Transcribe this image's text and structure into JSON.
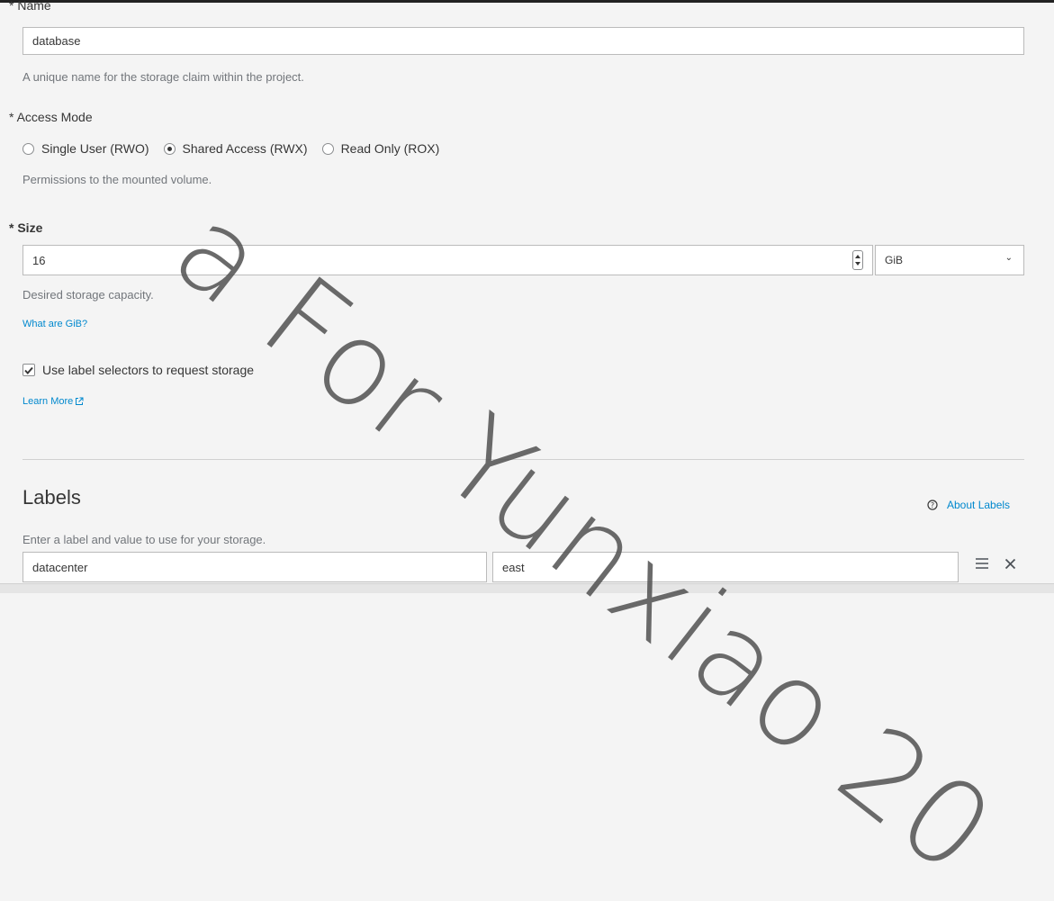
{
  "form": {
    "name": {
      "label": "* Name",
      "value": "database",
      "help": "A unique name for the storage claim within the project."
    },
    "access_mode": {
      "label": "* Access Mode",
      "options": [
        {
          "label": "Single User (RWO)",
          "selected": false
        },
        {
          "label": "Shared Access (RWX)",
          "selected": true
        },
        {
          "label": "Read Only (ROX)",
          "selected": false
        }
      ],
      "help": "Permissions to the mounted volume."
    },
    "size": {
      "label": "* Size",
      "value": "16",
      "unit": "GiB",
      "help": "Desired storage capacity.",
      "link": "What are GiB?"
    },
    "label_selectors": {
      "checkbox_label": "Use label selectors to request storage",
      "checked": true,
      "learn_more": "Learn More"
    }
  },
  "labels": {
    "heading": "Labels",
    "about": "About Labels",
    "help": "Enter a label and value to use for your storage.",
    "rows": [
      {
        "key": "datacenter",
        "value": "east"
      }
    ]
  },
  "watermark": "a For Yunxiao 20",
  "icons": {
    "radio": "radio-circle",
    "checkbox": "checkmark",
    "external_link": "external-link-icon",
    "help": "question-circle-icon",
    "drag": "drag-handle-icon",
    "remove": "close-icon"
  },
  "colors": {
    "link": "#0088ce",
    "background": "#f4f4f4",
    "text": "#363636"
  }
}
